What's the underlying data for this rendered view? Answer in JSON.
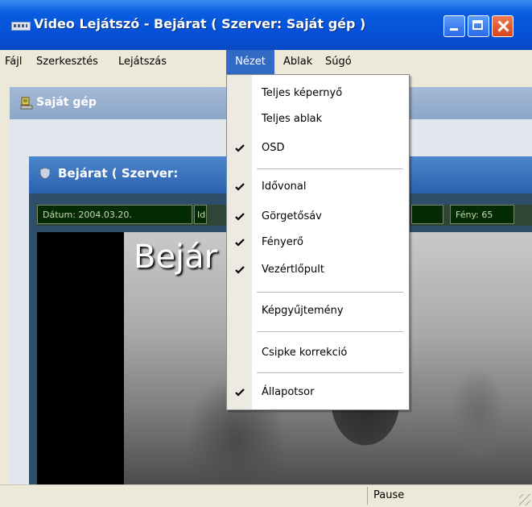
{
  "window": {
    "title": "Video Lejátszó - Bejárat ( Szerver: Saját gép )"
  },
  "menubar": {
    "items": [
      {
        "label": "Fájl"
      },
      {
        "label": "Szerkesztés"
      },
      {
        "label": "Lejátszás"
      },
      {
        "label": "Nézet",
        "active": true
      },
      {
        "label": "Ablak"
      },
      {
        "label": "Súgó"
      }
    ]
  },
  "child_window_1": {
    "title": "Saját gép"
  },
  "child_window_2": {
    "title": "Bejárat ( Szerver:",
    "info": {
      "date": "Dátum: 2004.03.20.",
      "time_partial": "Idő",
      "brightness": "Fény: 65"
    },
    "video_overlay_text": "Bejár"
  },
  "dropdown": {
    "menu": "Nézet",
    "items": [
      {
        "label": "Teljes képernyő",
        "checked": false
      },
      {
        "label": "Teljes ablak",
        "checked": false
      },
      {
        "label": "OSD",
        "checked": true
      },
      {
        "label": "Idővonal",
        "checked": true
      },
      {
        "label": "Görgetősáv",
        "checked": true
      },
      {
        "label": "Fényerő",
        "checked": true
      },
      {
        "label": "Vezértlőpult",
        "checked": true
      },
      {
        "label": "Képgyűjtemény",
        "checked": false
      },
      {
        "label": "Csipke korrekció",
        "checked": false
      },
      {
        "label": "Állapotsor",
        "checked": true
      }
    ]
  },
  "statusbar": {
    "text": "Pause"
  },
  "colors": {
    "titlebar": "#0a5ee0",
    "menu_highlight": "#316ac5",
    "info_text": "#c9d9a8"
  }
}
